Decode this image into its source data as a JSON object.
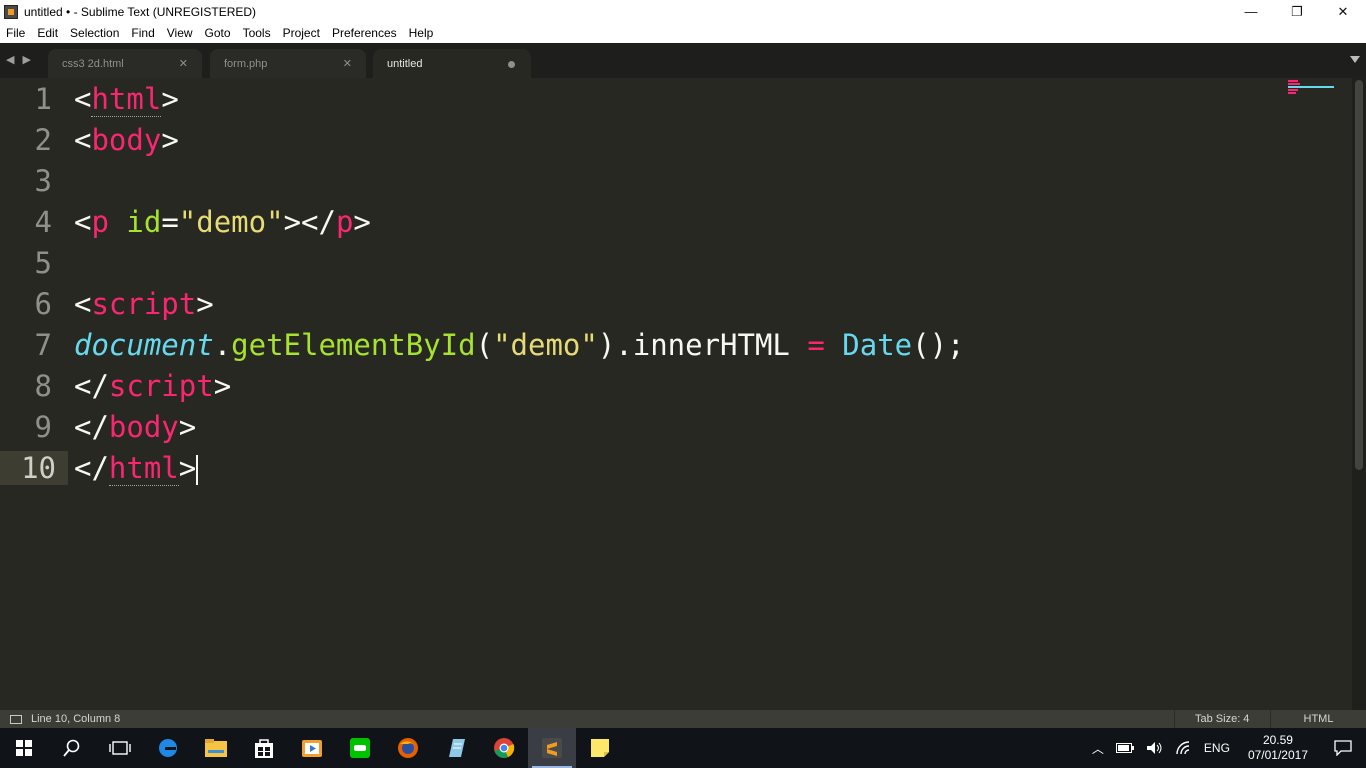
{
  "window": {
    "title": "untitled • - Sublime Text (UNREGISTERED)",
    "controls": {
      "minimize": "—",
      "restore": "❐",
      "close": "✕"
    }
  },
  "menu": [
    "File",
    "Edit",
    "Selection",
    "Find",
    "View",
    "Goto",
    "Tools",
    "Project",
    "Preferences",
    "Help"
  ],
  "tabs": [
    {
      "label": "css3 2d.html",
      "state": "closable"
    },
    {
      "label": "form.php",
      "state": "closable"
    },
    {
      "label": "untitled",
      "state": "modified-active"
    }
  ],
  "editor": {
    "lines": [
      {
        "number": "1",
        "tokens": [
          [
            "p",
            "<"
          ],
          [
            "tag u",
            "html"
          ],
          [
            "p",
            ">"
          ]
        ]
      },
      {
        "number": "2",
        "tokens": [
          [
            "p",
            "<"
          ],
          [
            "tag",
            "body"
          ],
          [
            "p",
            ">"
          ]
        ]
      },
      {
        "number": "3",
        "tokens": []
      },
      {
        "number": "4",
        "tokens": [
          [
            "p",
            "<"
          ],
          [
            "tag",
            "p"
          ],
          [
            "p",
            " "
          ],
          [
            "attr",
            "id"
          ],
          [
            "p",
            "="
          ],
          [
            "str",
            "\"demo\""
          ],
          [
            "p",
            "></"
          ],
          [
            "tag",
            "p"
          ],
          [
            "p",
            ">"
          ]
        ]
      },
      {
        "number": "5",
        "tokens": []
      },
      {
        "number": "6",
        "tokens": [
          [
            "p",
            "<"
          ],
          [
            "tag",
            "script"
          ],
          [
            "p",
            ">"
          ]
        ]
      },
      {
        "number": "7",
        "tokens": [
          [
            "ital",
            "document"
          ],
          [
            "p",
            "."
          ],
          [
            "fn",
            "getElementById"
          ],
          [
            "p",
            "("
          ],
          [
            "str",
            "\"demo\""
          ],
          [
            "p",
            ").innerHTML "
          ],
          [
            "kw",
            "="
          ],
          [
            "p",
            " "
          ],
          [
            "builtin",
            "Date"
          ],
          [
            "p",
            "();"
          ]
        ]
      },
      {
        "number": "8",
        "tokens": [
          [
            "p",
            "</"
          ],
          [
            "tag",
            "script"
          ],
          [
            "p",
            ">"
          ]
        ]
      },
      {
        "number": "9",
        "tokens": [
          [
            "p",
            "</"
          ],
          [
            "tag",
            "body"
          ],
          [
            "p",
            ">"
          ]
        ]
      },
      {
        "number": "10",
        "tokens": [
          [
            "p",
            "</"
          ],
          [
            "tag u",
            "html"
          ],
          [
            "p",
            ">"
          ]
        ],
        "current": true
      }
    ]
  },
  "status": {
    "position": "Line 10, Column 8",
    "tab_size": "Tab Size: 4",
    "syntax": "HTML"
  },
  "taskbar": {
    "apps": [
      "start-icon",
      "search-icon",
      "task-view-icon",
      "edge-icon",
      "file-explorer-icon",
      "store-icon",
      "media-player-icon",
      "line-icon",
      "firefox-icon",
      "notepad-icon",
      "chrome-icon",
      "sublime-text-icon",
      "sticky-notes-icon"
    ],
    "language": "ENG",
    "time": "20.59",
    "date": "07/01/2017"
  },
  "colors": {
    "background": "#272822",
    "tag": "#f92672",
    "attribute": "#a6e22e",
    "string": "#e6db74",
    "builtin": "#66d9ef"
  }
}
